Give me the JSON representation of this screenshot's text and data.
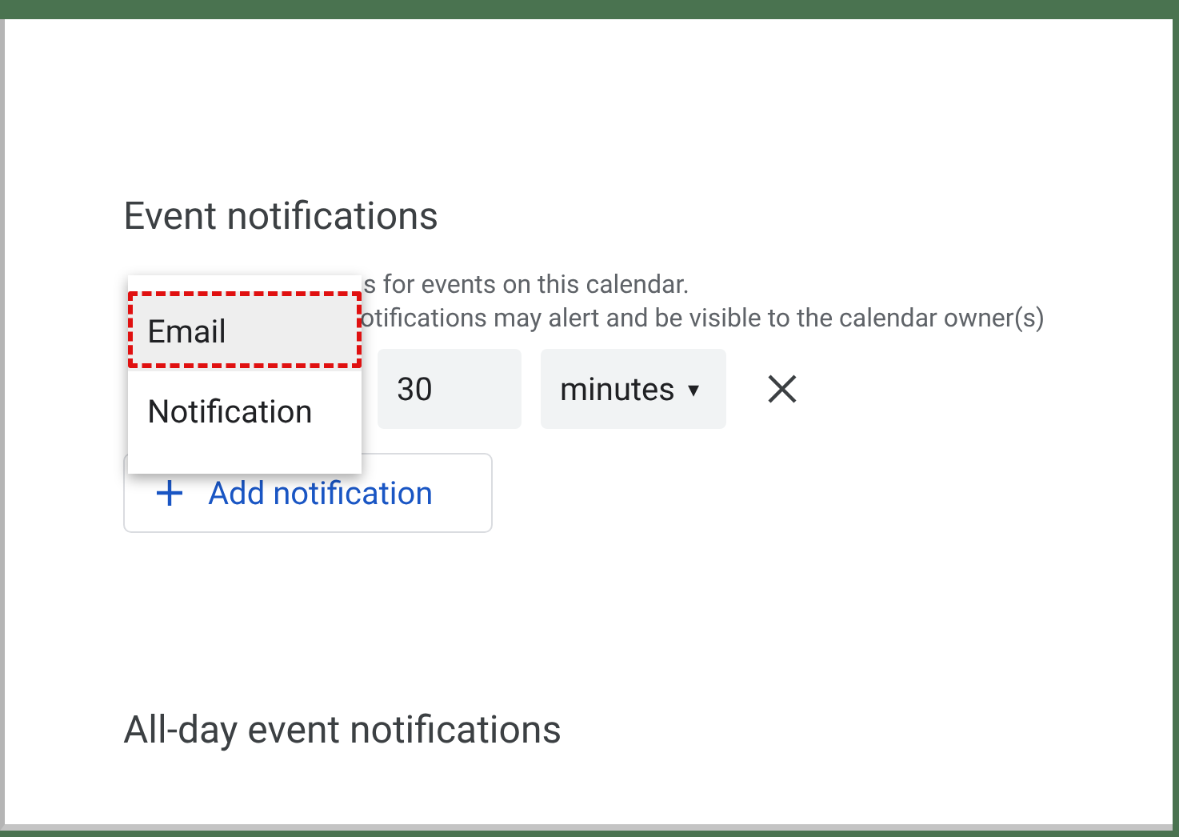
{
  "section_title": "Event notifications",
  "description": [
    "s for events on this calendar.",
    "otifications may alert and be visible to the calendar owner(s)"
  ],
  "notification": {
    "amount": "30",
    "unit": "minutes",
    "unit_caret": "▾"
  },
  "add_button": {
    "label": "Add notification"
  },
  "method_menu": {
    "items": [
      {
        "label": "Email",
        "selected": true,
        "highlighted": true
      },
      {
        "label": "Notification",
        "selected": false,
        "highlighted": false
      }
    ]
  },
  "next_section_title": "All-day event notifications"
}
